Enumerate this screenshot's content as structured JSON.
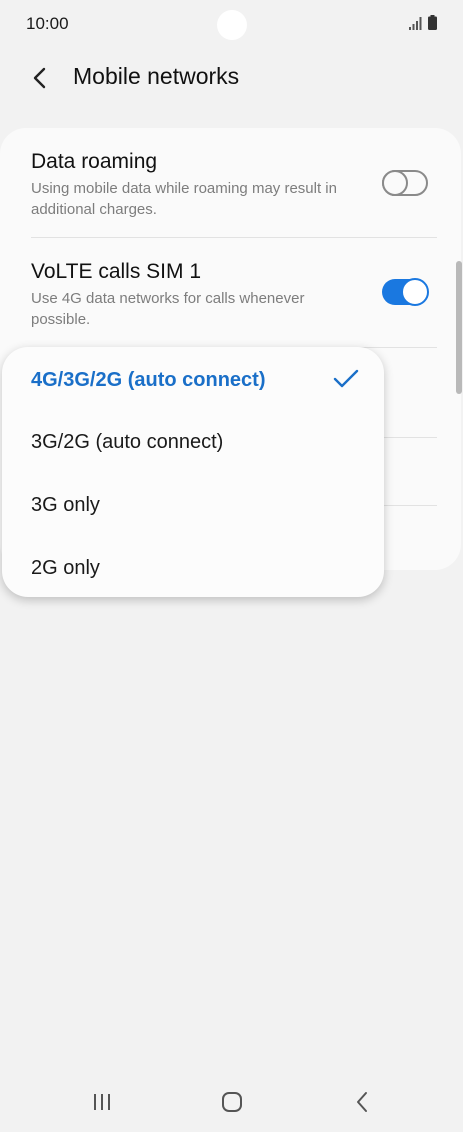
{
  "status_bar": {
    "time": "10:00"
  },
  "app_bar": {
    "title": "Mobile networks",
    "back_icon": "chevron-left-icon"
  },
  "settings": [
    {
      "title": "Data roaming",
      "description": "Using mobile data while roaming may result in additional charges.",
      "toggle": "off"
    },
    {
      "title": "VoLTE calls SIM 1",
      "description": "Use 4G data networks for calls whenever possible.",
      "toggle": "on"
    }
  ],
  "network_mode_menu": {
    "options": [
      {
        "label": "4G/3G/2G (auto connect)",
        "selected": true
      },
      {
        "label": "3G/2G (auto connect)",
        "selected": false
      },
      {
        "label": "3G only",
        "selected": false
      },
      {
        "label": "2G only",
        "selected": false
      }
    ]
  },
  "nav_bar": {
    "recents_icon": "recents-icon",
    "home_icon": "home-icon",
    "back_icon": "back-icon"
  },
  "colors": {
    "accent": "#1a78e0",
    "selected_text": "#1a6fc8",
    "background": "#f2f2f2",
    "card": "#fafafa"
  }
}
